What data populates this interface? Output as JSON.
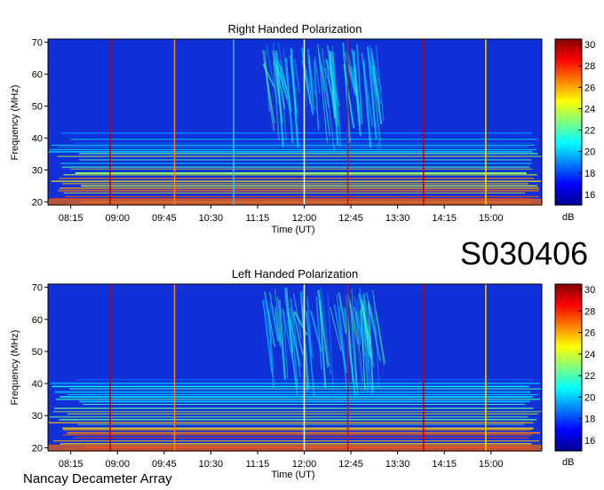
{
  "station_id": "S030406",
  "footer": "Nancay Decameter Array",
  "chart_data": [
    {
      "type": "heatmap",
      "title": "Right Handed Polarization",
      "xlabel": "Time (UT)",
      "ylabel": "Frequency (MHz)",
      "x_ticks": [
        "08:15",
        "09:00",
        "09:45",
        "10:30",
        "11:15",
        "12:00",
        "12:45",
        "13:30",
        "14:15",
        "15:00"
      ],
      "y_ticks": [
        20,
        30,
        40,
        50,
        60,
        70
      ],
      "ylim": [
        19,
        71
      ],
      "colorbar": {
        "label": "dB",
        "ticks": [
          16,
          18,
          20,
          22,
          24,
          26,
          28,
          30
        ],
        "range": [
          15,
          30.5
        ]
      },
      "vertical_lines": [
        {
          "time": "08:53",
          "color": "#c00000"
        },
        {
          "time": "09:55",
          "color": "#ff7a1a"
        },
        {
          "time": "10:52",
          "color": "#30c0ff"
        },
        {
          "time": "12:00",
          "color": "#e8f4ff"
        },
        {
          "time": "12:42",
          "color": "#d01010"
        },
        {
          "time": "13:55",
          "color": "#c00000"
        },
        {
          "time": "14:55",
          "color": "#ffd000"
        }
      ]
    },
    {
      "type": "heatmap",
      "title": "Left Handed Polarization",
      "xlabel": "Time (UT)",
      "ylabel": "Frequency (MHz)",
      "x_ticks": [
        "08:15",
        "09:00",
        "09:45",
        "10:30",
        "11:15",
        "12:00",
        "12:45",
        "13:30",
        "14:15",
        "15:00"
      ],
      "y_ticks": [
        20,
        30,
        40,
        50,
        60,
        70
      ],
      "ylim": [
        19,
        71
      ],
      "colorbar": {
        "label": "dB",
        "ticks": [
          16,
          18,
          20,
          22,
          24,
          26,
          28,
          30
        ],
        "range": [
          15,
          30.5
        ]
      },
      "vertical_lines": [
        {
          "time": "08:53",
          "color": "#c00000"
        },
        {
          "time": "09:55",
          "color": "#ff7a1a"
        },
        {
          "time": "12:00",
          "color": "#e8f4ff"
        },
        {
          "time": "12:42",
          "color": "#d01010"
        },
        {
          "time": "13:55",
          "color": "#c00000"
        },
        {
          "time": "14:55",
          "color": "#ffd000"
        }
      ]
    }
  ]
}
